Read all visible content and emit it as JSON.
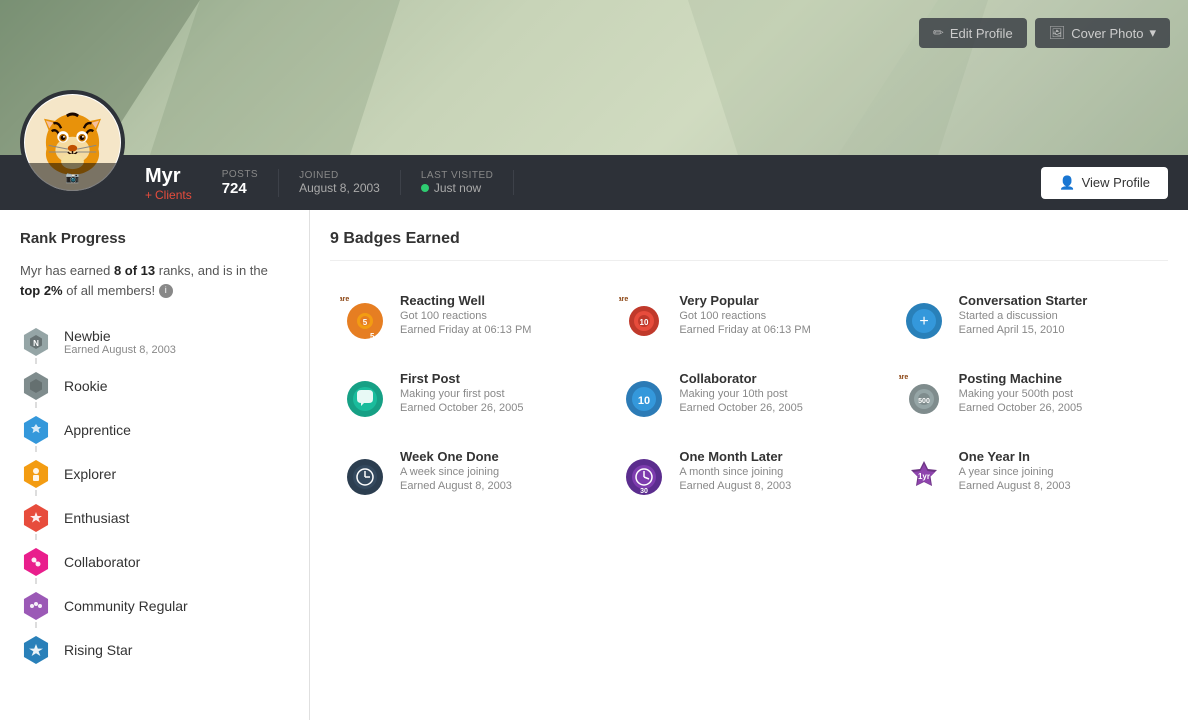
{
  "header": {
    "edit_profile_label": "Edit Profile",
    "cover_photo_label": "Cover Photo",
    "view_profile_label": "View Profile"
  },
  "user": {
    "name": "Myr",
    "tag": "Clients",
    "posts_label": "POSTS",
    "posts_count": "724",
    "joined_label": "JOINED",
    "joined_date": "August 8, 2003",
    "last_visited_label": "LAST VISITED",
    "last_visited_value": "Just now"
  },
  "rank_progress": {
    "title": "Rank Progress",
    "description_pre": "Myr has earned ",
    "earned": "8 of 13",
    "description_mid": " ranks, and is in the ",
    "top_percent": "top 2%",
    "description_post": " of all members!",
    "ranks": [
      {
        "name": "Newbie",
        "earned": "Earned August 8, 2003",
        "color": "#95a5a6",
        "earned_status": true
      },
      {
        "name": "Rookie",
        "earned": "",
        "color": "#7f8c8d",
        "earned_status": true
      },
      {
        "name": "Apprentice",
        "earned": "",
        "color": "#3498db",
        "earned_status": true
      },
      {
        "name": "Explorer",
        "earned": "",
        "color": "#f39c12",
        "earned_status": true
      },
      {
        "name": "Enthusiast",
        "earned": "",
        "color": "#e74c3c",
        "earned_status": true
      },
      {
        "name": "Collaborator",
        "earned": "",
        "color": "#e91e8c",
        "earned_status": true
      },
      {
        "name": "Community Regular",
        "earned": "",
        "color": "#9b59b6",
        "earned_status": true
      },
      {
        "name": "Rising Star",
        "earned": "",
        "color": "#3498db",
        "earned_status": true
      }
    ]
  },
  "badges": {
    "title": "9 Badges Earned",
    "items": [
      {
        "name": "Reacting Well",
        "desc": "Got 100 reactions",
        "date": "Earned Friday at 06:13 PM",
        "type": "gear",
        "color": "#e67e22",
        "rare": true,
        "num": "5"
      },
      {
        "name": "Very Popular",
        "desc": "Got 100 reactions",
        "date": "Earned Friday at 06:13 PM",
        "type": "gear2",
        "color": "#e74c3c",
        "rare": true,
        "num": "10"
      },
      {
        "name": "Conversation Starter",
        "desc": "Started a discussion",
        "date": "Earned April 15, 2010",
        "type": "circle-blue",
        "color": "#2980b9",
        "rare": false,
        "num": ""
      },
      {
        "name": "First Post",
        "desc": "Making your first post",
        "date": "Earned October 26, 2005",
        "type": "circle-teal",
        "color": "#16a085",
        "rare": false,
        "num": ""
      },
      {
        "name": "Collaborator",
        "desc": "Making your 10th post",
        "date": "Earned October 26, 2005",
        "type": "circle-blue2",
        "color": "#2c7bb6",
        "rare": false,
        "num": "10"
      },
      {
        "name": "Posting Machine",
        "desc": "Making your 500th post",
        "date": "Earned October 26, 2005",
        "type": "gear3",
        "color": "#95a5a6",
        "rare": true,
        "num": ""
      },
      {
        "name": "Week One Done",
        "desc": "A week since joining",
        "date": "Earned August 8, 2003",
        "type": "clock-dark",
        "color": "#2c3e50",
        "rare": false,
        "num": ""
      },
      {
        "name": "One Month Later",
        "desc": "A month since joining",
        "date": "Earned August 8, 2003",
        "type": "clock-purple",
        "color": "#5b2d8e",
        "rare": false,
        "num": ""
      },
      {
        "name": "One Year In",
        "desc": "A year since joining",
        "date": "Earned August 8, 2003",
        "type": "hex-purple",
        "color": "#6c3483",
        "rare": false,
        "num": ""
      }
    ]
  }
}
